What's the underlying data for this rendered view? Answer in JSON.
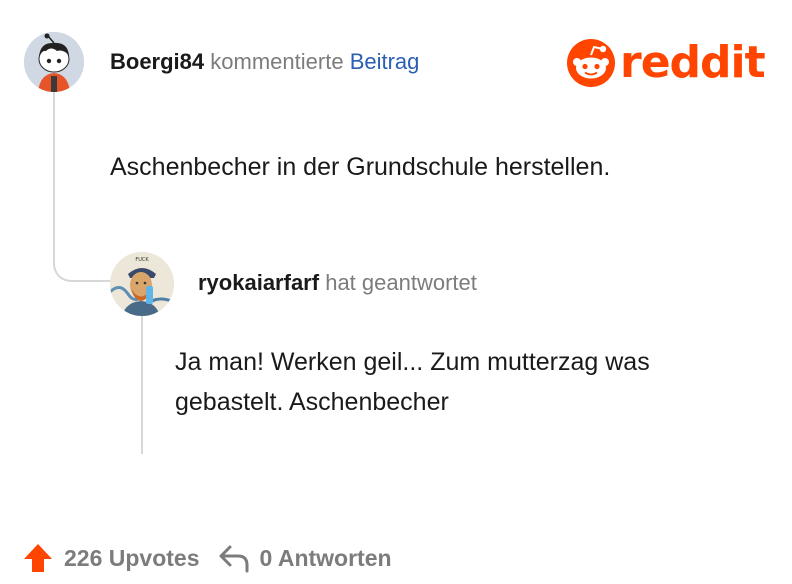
{
  "brand": {
    "logo_text": "reddit",
    "color": "#ff4500"
  },
  "op_comment": {
    "username": "Boergi84",
    "action": "kommentierte",
    "target": "Beitrag",
    "body": "Aschenbecher in der Grundschule herstellen.",
    "avatar_icon": "snoo-avatar-icon"
  },
  "reply_comment": {
    "username": "ryokaiarfarf",
    "action": "hat geantwortet",
    "body": "Ja man! Werken geil... Zum mutterzag was gebastelt. Aschenbecher",
    "avatar_icon": "van-gogh-avatar-icon",
    "avatar_caption": "FUCK"
  },
  "footer": {
    "upvotes_label": "226 Upvotes",
    "replies_label": "0 Antworten",
    "upvote_icon": "upvote-arrow-icon",
    "reply_icon": "reply-arrow-icon"
  },
  "colors": {
    "text": "#1a1a1b",
    "muted": "#7c7c7c",
    "link": "#2b5fb3",
    "thread_line": "#d7d7d7"
  }
}
